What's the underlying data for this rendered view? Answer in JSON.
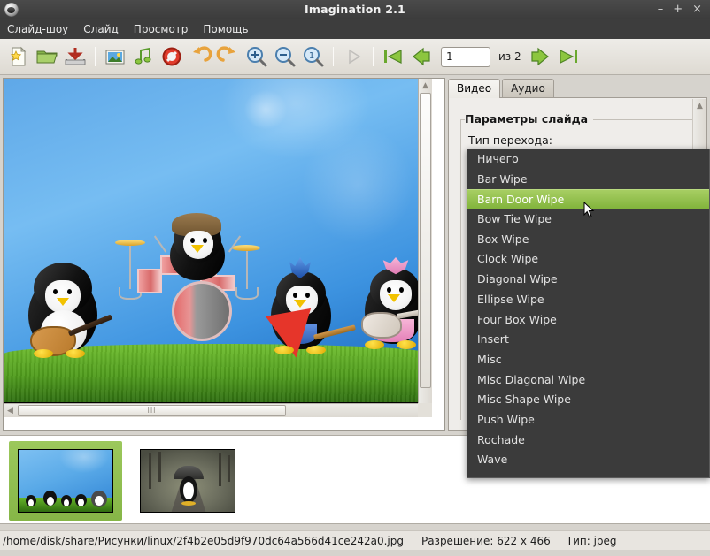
{
  "window": {
    "title": "Imagination 2.1",
    "icon": "app-icon",
    "minimize": "–",
    "maximize": "+",
    "close": "×"
  },
  "menubar": {
    "items": [
      {
        "label": "Слайд-шоу",
        "accel": "С"
      },
      {
        "label": "Слайд",
        "accel": "а"
      },
      {
        "label": "Просмотр",
        "accel": "П"
      },
      {
        "label": "Помощь",
        "accel": "П"
      }
    ]
  },
  "toolbar": {
    "buttons": [
      {
        "name": "new-slideshow-icon",
        "tooltip": "Создать"
      },
      {
        "name": "open-folder-icon",
        "tooltip": "Открыть"
      },
      {
        "name": "save-icon",
        "tooltip": "Сохранить"
      },
      {
        "name": "add-image-icon",
        "tooltip": "Добавить изображение"
      },
      {
        "name": "add-music-icon",
        "tooltip": "Добавить музыку"
      },
      {
        "name": "delete-icon",
        "tooltip": "Удалить"
      },
      {
        "name": "rotate-left-icon",
        "tooltip": "Повернуть влево"
      },
      {
        "name": "rotate-right-icon",
        "tooltip": "Повернуть вправо"
      },
      {
        "name": "zoom-in-icon",
        "tooltip": "Увеличить"
      },
      {
        "name": "zoom-out-icon",
        "tooltip": "Уменьшить"
      },
      {
        "name": "zoom-normal-icon",
        "tooltip": "Нормальный размер"
      },
      {
        "name": "play-icon",
        "tooltip": "Начать показ"
      }
    ],
    "navigation": {
      "first": "first-slide-icon",
      "previous": "previous-slide-icon",
      "next": "next-slide-icon",
      "last": "last-slide-icon",
      "page_value": "1",
      "page_of_label": "из 2"
    }
  },
  "panel": {
    "tabs": [
      {
        "label": "Видео",
        "active": true
      },
      {
        "label": "Аудио",
        "active": false
      }
    ],
    "frame_title": "Параметры слайда",
    "field_label": "Тип перехода:"
  },
  "dropdown": {
    "selected": "Barn Door Wipe",
    "items": [
      "Ничего",
      "Bar Wipe",
      "Barn Door Wipe",
      "Bow Tie Wipe",
      "Box Wipe",
      "Clock Wipe",
      "Diagonal Wipe",
      "Ellipse Wipe",
      "Four Box Wipe",
      "Insert",
      "Misc",
      "Misc Diagonal Wipe",
      "Misc Shape Wipe",
      "Push Wipe",
      "Rochade",
      "Wave"
    ]
  },
  "thumbnails": [
    {
      "name": "slide-1",
      "selected": true,
      "alt": "Penguins rock band on grass"
    },
    {
      "name": "slide-2",
      "selected": false,
      "alt": "Penguin with umbrella on rainy path"
    }
  ],
  "statusbar": {
    "path": "/home/disk/share/Рисунки/linux/2f4b2e05d9f970dc64a566d41ce242a0.jpg",
    "resolution": "Разрешение: 622 x 466",
    "type": "Тип: jpeg"
  },
  "colors": {
    "titlebar": "#434343",
    "menubar": "#3d3d3d",
    "dropdown_bg": "#3b3b3b",
    "dropdown_selected": "#8cbf4a",
    "thumb_selected": "#8fbe4e",
    "toolbar_bg": "#e6e3dd"
  }
}
